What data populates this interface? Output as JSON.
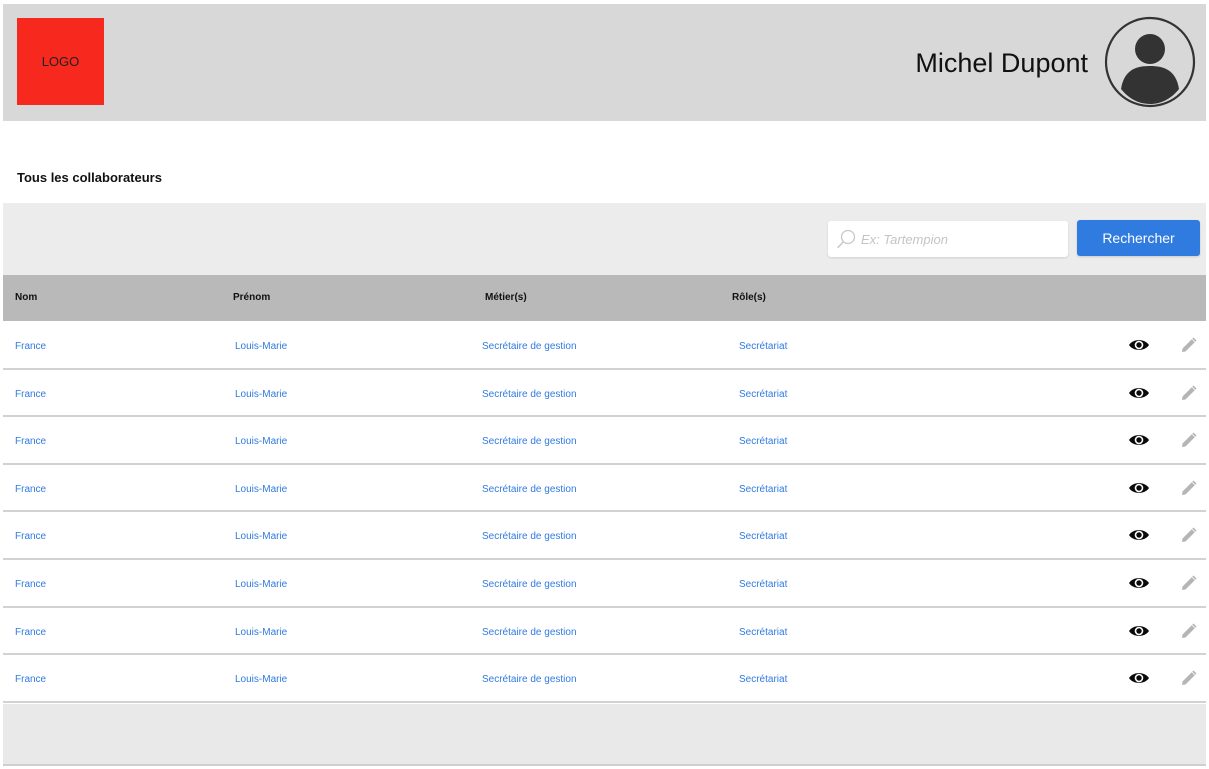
{
  "header": {
    "logo_text": "LOGO",
    "user_name": "Michel Dupont",
    "avatar_icon": "user-avatar-icon"
  },
  "page_title": "Tous les collaborateurs",
  "search": {
    "placeholder": "Ex: Tartempion",
    "value": "",
    "button_label": "Rechercher",
    "icon": "search-icon"
  },
  "table": {
    "columns": [
      "Nom",
      "Prénom",
      "Métier(s)",
      "Rôle(s)"
    ],
    "rows": [
      [
        "France",
        "Louis-Marie",
        "Secrétaire de gestion",
        "Secrétariat"
      ],
      [
        "France",
        "Louis-Marie",
        "Secrétaire de gestion",
        "Secrétariat"
      ],
      [
        "France",
        "Louis-Marie",
        "Secrétaire de gestion",
        "Secrétariat"
      ],
      [
        "France",
        "Louis-Marie",
        "Secrétaire de gestion",
        "Secrétariat"
      ],
      [
        "France",
        "Louis-Marie",
        "Secrétaire de gestion",
        "Secrétariat"
      ],
      [
        "France",
        "Louis-Marie",
        "Secrétaire de gestion",
        "Secrétariat"
      ],
      [
        "France",
        "Louis-Marie",
        "Secrétaire de gestion",
        "Secrétariat"
      ],
      [
        "France",
        "Louis-Marie",
        "Secrétaire de gestion",
        "Secrétariat"
      ]
    ],
    "row_actions": [
      "eye-icon",
      "pencil-icon"
    ]
  },
  "colors": {
    "logo": "#f7281e",
    "accent": "#2f7be0",
    "header_bg": "#d8d8d8",
    "table_header_bg": "#b9b9b9"
  }
}
